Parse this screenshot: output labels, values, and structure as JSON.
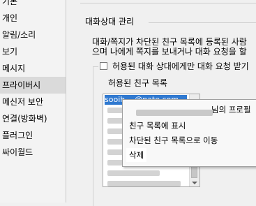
{
  "sidebar": {
    "items": [
      {
        "label": "기본"
      },
      {
        "label": "개인"
      },
      {
        "label": "알림/소리"
      },
      {
        "label": "보기"
      },
      {
        "label": "메시지"
      },
      {
        "label": "프라이버시"
      },
      {
        "label": "메신저 보안"
      },
      {
        "label": "연결(방화벽)"
      },
      {
        "label": "플러그인"
      },
      {
        "label": "싸이월드"
      }
    ],
    "selected_index": 5
  },
  "section": {
    "title": "대화상대 관리",
    "description_line1": "대화/쪽지가 차단된 친구 목록에 등록된 사람",
    "description_line2": "으며 나에게 쪽지를 보내거나 대화 요청을 할"
  },
  "option": {
    "checkbox_label": "허용된 대화 상대에게만 대화 요청 받기",
    "checked": false
  },
  "allowed_list": {
    "title": "허용된 친구 목록",
    "selected_row_text": "sooih ...@nate.com"
  },
  "context_menu": {
    "profile_suffix": "님의 프로필",
    "items": [
      {
        "label": "친구 목록에 표시"
      },
      {
        "label": "차단된 친구 목록으로 이동"
      },
      {
        "label": "삭제"
      }
    ]
  }
}
